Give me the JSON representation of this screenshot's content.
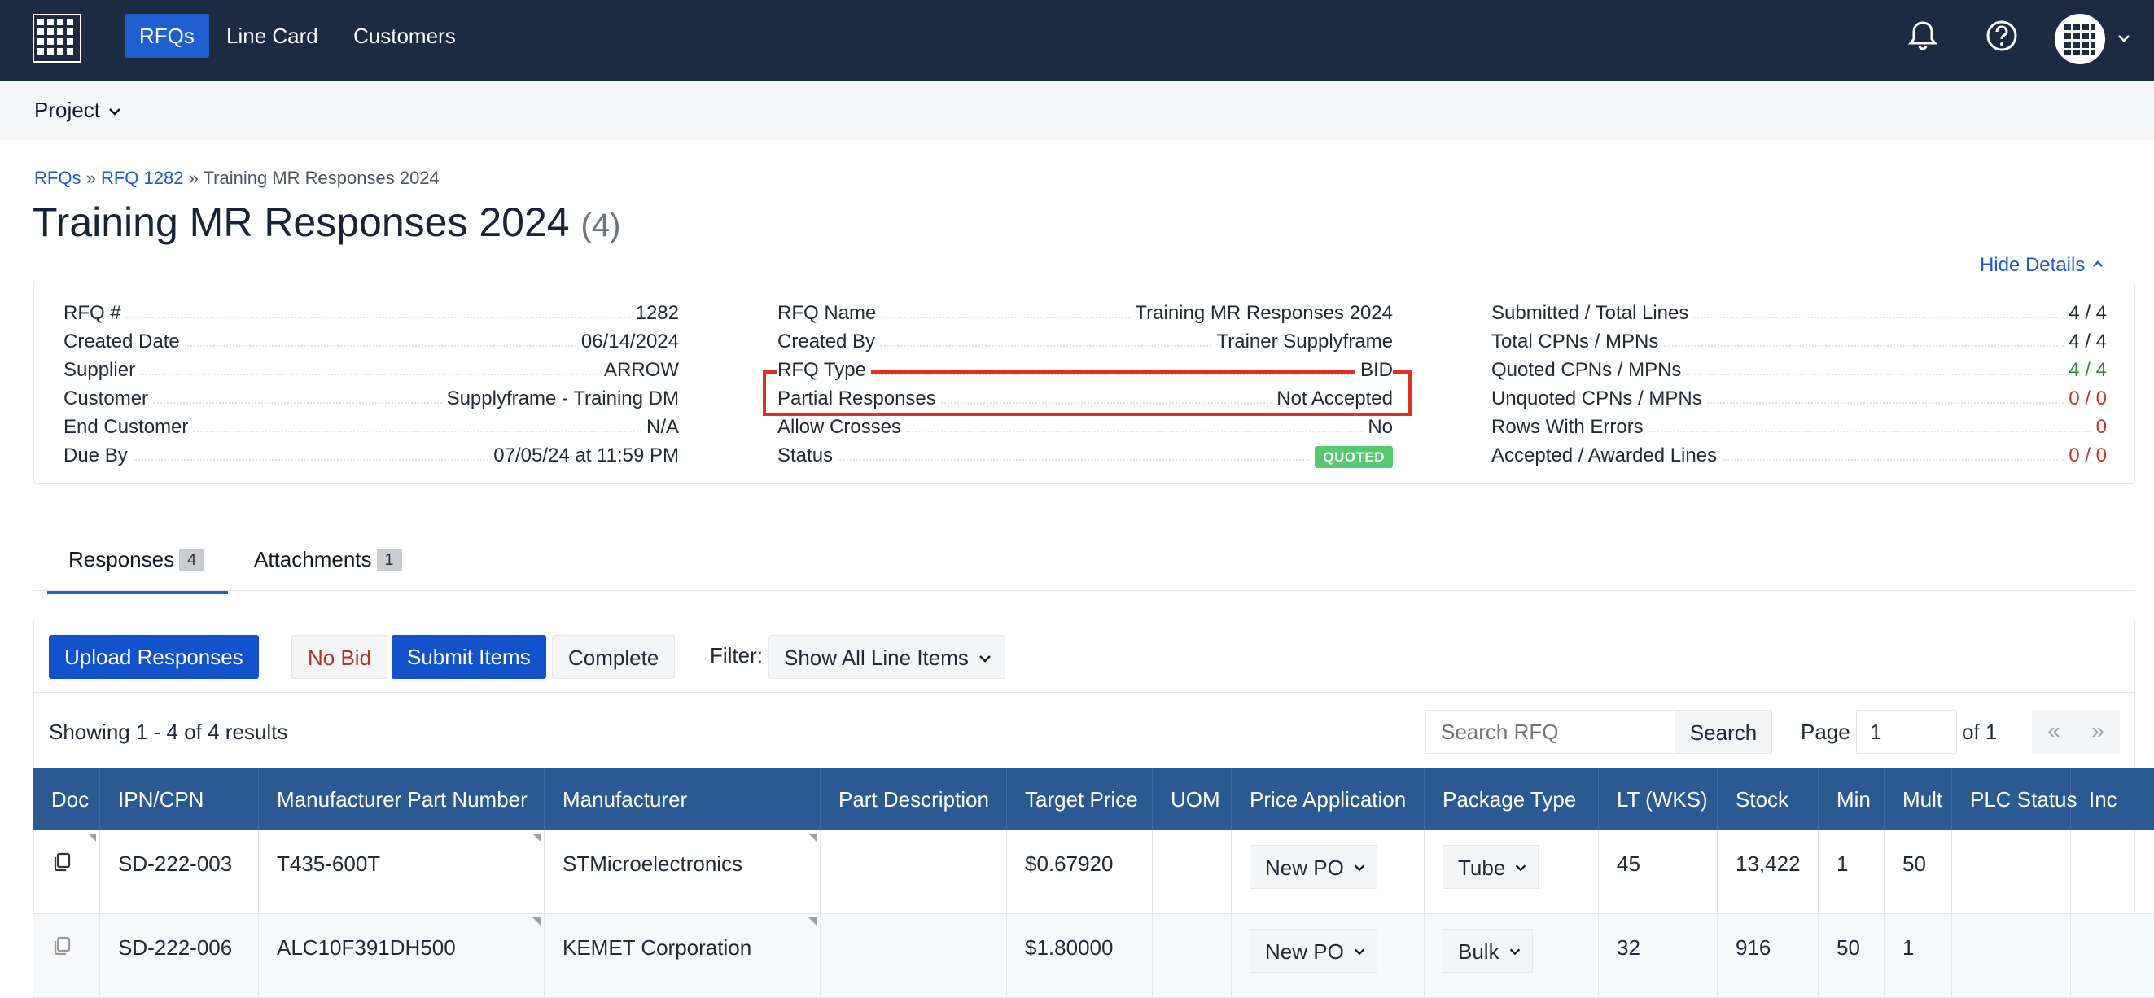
{
  "nav": {
    "items": [
      {
        "label": "RFQs",
        "active": true
      },
      {
        "label": "Line Card",
        "active": false
      },
      {
        "label": "Customers",
        "active": false
      }
    ],
    "icons": [
      "bell-icon",
      "help-icon",
      "avatar-grid-icon"
    ]
  },
  "project": {
    "label": "Project"
  },
  "breadcrumb": {
    "root": "RFQs",
    "sep": "»",
    "rfq": "RFQ 1282",
    "current": "Training MR Responses 2024"
  },
  "title": {
    "text": "Training MR Responses 2024",
    "count": "(4)"
  },
  "hide_details": "Hide Details",
  "details": {
    "col1": [
      {
        "k": "RFQ #",
        "v": "1282"
      },
      {
        "k": "Created Date",
        "v": "06/14/2024"
      },
      {
        "k": "Supplier",
        "v": "ARROW"
      },
      {
        "k": "Customer",
        "v": "Supplyframe - Training DM"
      },
      {
        "k": "End Customer",
        "v": "N/A"
      },
      {
        "k": "Due By",
        "v": "07/05/24 at 11:59 PM"
      }
    ],
    "col2": [
      {
        "k": "RFQ Name",
        "v": "Training MR Responses 2024"
      },
      {
        "k": "Created By",
        "v": "Trainer Supplyframe"
      },
      {
        "k": "RFQ Type",
        "v": "BID"
      },
      {
        "k": "Partial Responses",
        "v": "Not Accepted"
      },
      {
        "k": "Allow Crosses",
        "v": "No"
      },
      {
        "k": "Status",
        "v": "QUOTED"
      }
    ],
    "col3": [
      {
        "k": "Submitted / Total Lines",
        "v": "4 / 4"
      },
      {
        "k": "Total CPNs / MPNs",
        "v": "4 / 4"
      },
      {
        "k": "Quoted CPNs / MPNs",
        "v": "4 / 4"
      },
      {
        "k": "Unquoted CPNs / MPNs",
        "v": "0 / 0"
      },
      {
        "k": "Rows With Errors",
        "v": "0"
      },
      {
        "k": "Accepted / Awarded Lines",
        "v": "0 / 0"
      }
    ]
  },
  "tabs": [
    {
      "label": "Responses",
      "badge": "4"
    },
    {
      "label": "Attachments",
      "badge": "1"
    }
  ],
  "toolbar": {
    "upload": "Upload Responses",
    "nobid": "No Bid",
    "submit": "Submit Items",
    "complete": "Complete",
    "filter_label": "Filter:",
    "filter_value": "Show All Line Items"
  },
  "results": {
    "showing": "Showing 1 - 4 of 4 results",
    "search_placeholder": "Search RFQ",
    "search_btn": "Search",
    "page_label": "Page",
    "page_value": "1",
    "page_of": "of 1",
    "first": "«",
    "last": "»"
  },
  "table": {
    "headers": [
      "Doc",
      "IPN/CPN",
      "Manufacturer Part Number",
      "Manufacturer",
      "Part Description",
      "Target Price",
      "UOM",
      "Price Application",
      "Package Type",
      "LT (WKS)",
      "Stock",
      "Min",
      "Mult",
      "PLC Status",
      "Inc"
    ],
    "rows": [
      {
        "cpn": "SD-222-003",
        "mpn": "T435-600T",
        "mfr": "STMicroelectronics",
        "desc": "",
        "price": "$0.67920",
        "uom": "",
        "app": "New PO",
        "pkg": "Tube",
        "lt": "45",
        "stock": "13,422",
        "min": "1",
        "mult": "50",
        "plc": "",
        "inc": ""
      },
      {
        "cpn": "SD-222-006",
        "mpn": "ALC10F391DH500",
        "mfr": "KEMET Corporation",
        "desc": "",
        "price": "$1.80000",
        "uom": "",
        "app": "New PO",
        "pkg": "Bulk",
        "lt": "32",
        "stock": "916",
        "min": "50",
        "mult": "1",
        "plc": "",
        "inc": ""
      }
    ]
  },
  "colors": {
    "nav_bg": "#1c2b42",
    "accent": "#1f5fd0",
    "table_head": "#2b5a93",
    "status_quoted": "#55c970",
    "highlight": "#e0301e"
  }
}
